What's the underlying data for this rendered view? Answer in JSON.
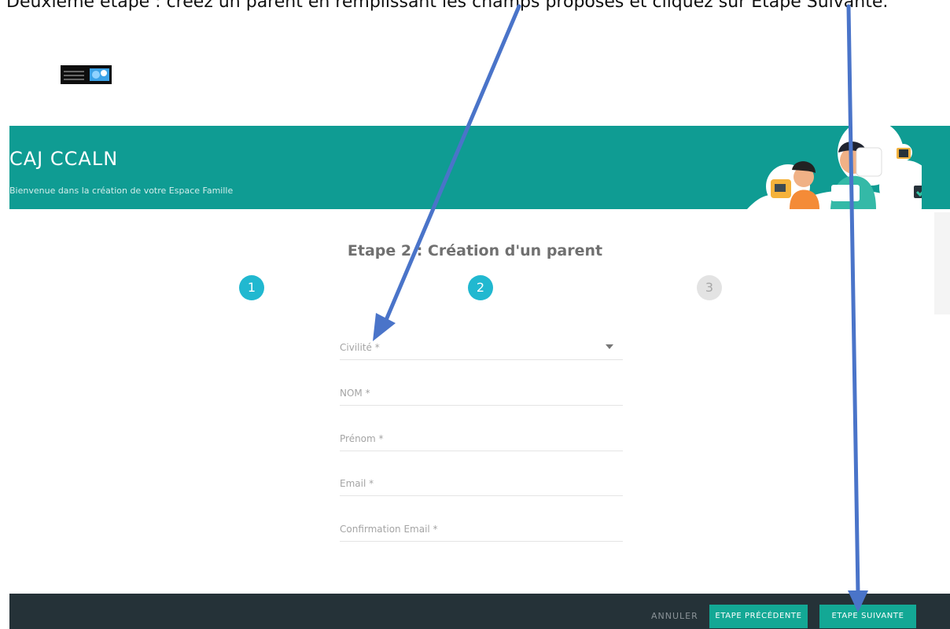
{
  "instruction": "Deuxième étape : créez un parent en remplissant les champs proposés et cliquez sur Etape Suivante.",
  "header": {
    "title": "CAJ CCALN",
    "subtitle": "Bienvenue dans la création de votre Espace Famille"
  },
  "step_title": "Etape 2 : Création d'un parent",
  "steps": [
    "1",
    "2",
    "3"
  ],
  "current_step": 2,
  "form": {
    "civility": {
      "placeholder": "Civilité *"
    },
    "nom": {
      "placeholder": "NOM *"
    },
    "prenom": {
      "placeholder": "Prénom *"
    },
    "email": {
      "placeholder": "Email *"
    },
    "email_confirm": {
      "placeholder": "Confirmation Email *"
    }
  },
  "footer": {
    "cancel": "ANNULER",
    "previous": "ETAPE PRÉCÉDENTE",
    "next": "ETAPE SUIVANTE"
  },
  "colors": {
    "header": "#0f9c93",
    "step_active": "#21b8d0",
    "footer": "#253238",
    "button": "#13a895",
    "annotation_arrow": "#4a74c9"
  }
}
